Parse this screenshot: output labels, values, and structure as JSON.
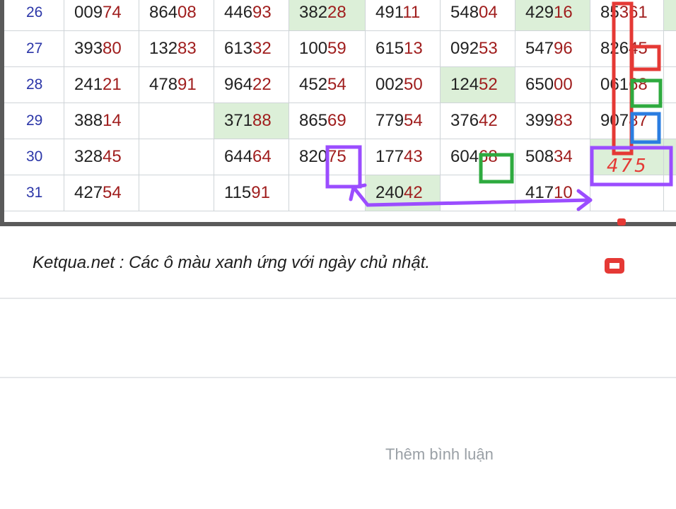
{
  "table": {
    "rows": [
      {
        "day": "26",
        "cells": [
          {
            "p": "009",
            "s": "74",
            "g": false
          },
          {
            "p": "864",
            "s": "08",
            "g": false
          },
          {
            "p": "446",
            "s": "93",
            "g": false
          },
          {
            "p": "382",
            "s": "28",
            "g": true
          },
          {
            "p": "491",
            "s": "11",
            "g": false
          },
          {
            "p": "548",
            "s": "04",
            "g": false
          },
          {
            "p": "429",
            "s": "16",
            "g": true
          },
          {
            "p": "85",
            "s": "361",
            "g": false
          }
        ]
      },
      {
        "day": "27",
        "cells": [
          {
            "p": "393",
            "s": "80",
            "g": false
          },
          {
            "p": "132",
            "s": "83",
            "g": false
          },
          {
            "p": "613",
            "s": "32",
            "g": false
          },
          {
            "p": "100",
            "s": "59",
            "g": false
          },
          {
            "p": "615",
            "s": "13",
            "g": false
          },
          {
            "p": "092",
            "s": "53",
            "g": false
          },
          {
            "p": "547",
            "s": "96",
            "g": false
          },
          {
            "p": "826",
            "s": "45",
            "g": false
          }
        ]
      },
      {
        "day": "28",
        "cells": [
          {
            "p": "241",
            "s": "21",
            "g": false
          },
          {
            "p": "478",
            "s": "91",
            "g": false
          },
          {
            "p": "964",
            "s": "22",
            "g": false
          },
          {
            "p": "452",
            "s": "54",
            "g": false
          },
          {
            "p": "002",
            "s": "50",
            "g": false
          },
          {
            "p": "124",
            "s": "52",
            "g": true
          },
          {
            "p": "650",
            "s": "00",
            "g": false
          },
          {
            "p": "061",
            "s": "68",
            "g": false
          }
        ]
      },
      {
        "day": "29",
        "cells": [
          {
            "p": "388",
            "s": "14",
            "g": false
          },
          {
            "p": "",
            "s": "",
            "g": false
          },
          {
            "p": "371",
            "s": "88",
            "g": true
          },
          {
            "p": "865",
            "s": "69",
            "g": false
          },
          {
            "p": "779",
            "s": "54",
            "g": false
          },
          {
            "p": "376",
            "s": "42",
            "g": false
          },
          {
            "p": "399",
            "s": "83",
            "g": false
          },
          {
            "p": "907",
            "s": "87",
            "g": false
          }
        ]
      },
      {
        "day": "30",
        "cells": [
          {
            "p": "328",
            "s": "45",
            "g": false
          },
          {
            "p": "",
            "s": "",
            "g": false
          },
          {
            "p": "644",
            "s": "64",
            "g": false
          },
          {
            "p": "820",
            "s": "75",
            "g": false
          },
          {
            "p": "177",
            "s": "43",
            "g": false
          },
          {
            "p": "604",
            "s": "68",
            "g": false
          },
          {
            "p": "508",
            "s": "34",
            "g": false
          },
          {
            "p": "",
            "s": "",
            "g": true
          }
        ]
      },
      {
        "day": "31",
        "cells": [
          {
            "p": "427",
            "s": "54",
            "g": false
          },
          {
            "p": "",
            "s": "",
            "g": false
          },
          {
            "p": "115",
            "s": "91",
            "g": false
          },
          {
            "p": "",
            "s": "",
            "g": false
          },
          {
            "p": "240",
            "s": "42",
            "g": true
          },
          {
            "p": "",
            "s": "",
            "g": false
          },
          {
            "p": "417",
            "s": "10",
            "g": false
          },
          {
            "p": "",
            "s": "",
            "g": false
          }
        ]
      }
    ]
  },
  "note": "Ketqua.net : Các ô màu xanh ứng với ngày chủ nhật.",
  "comment_placeholder": "Thêm bình luận",
  "annotation": {
    "handwritten": "475",
    "colors": {
      "red": "#e53935",
      "green": "#2eaa3f",
      "blue": "#2a7de1",
      "purple": "#9b4dff"
    }
  },
  "colors": {
    "day_number": "#2b36a8",
    "highlight_digits": "#a01e1e",
    "sunday_cell": "#dcefd8",
    "grid_line": "#cfd4d8"
  }
}
